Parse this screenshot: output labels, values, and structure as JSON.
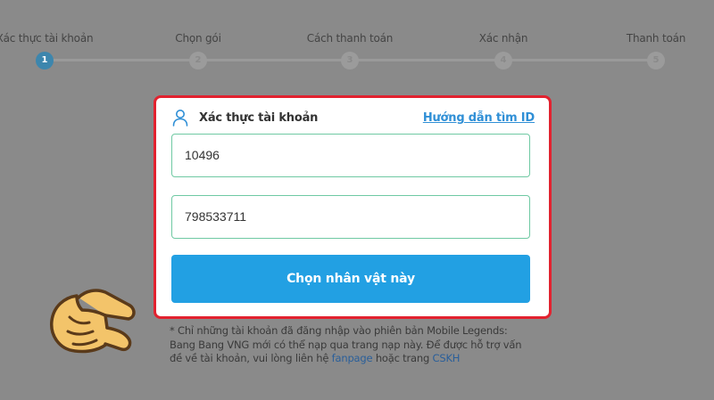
{
  "steps": [
    {
      "label": "Xác thực tài khoản",
      "number": "1"
    },
    {
      "label": "Chọn gói",
      "number": "2"
    },
    {
      "label": "Cách thanh toán",
      "number": "3"
    },
    {
      "label": "Xác nhận",
      "number": "4"
    },
    {
      "label": "Thanh toán",
      "number": "5"
    }
  ],
  "card": {
    "title": "Xác thực tài khoản",
    "help_link": "Hướng dẫn tìm ID",
    "field1_value": "10496",
    "field2_value": "798533711",
    "submit_label": "Chọn nhân vật này"
  },
  "note": {
    "text_1": "* Chỉ những tài khoản đã đăng nhập vào phiên bản Mobile Legends: Bang Bang VNG mới có thể nạp qua trang nạp này. Để được hỗ trợ vấn đề về tài khoản, vui lòng liên hệ ",
    "link_1": "fanpage",
    "text_2": " hoặc trang ",
    "link_2": "CSKH"
  },
  "colors": {
    "highlight": "#e2222f",
    "button": "#22a0e3",
    "link": "#2f8fd6",
    "active_step": "#3d86ad"
  },
  "icons": [
    "user-icon",
    "pointing-hand-icon"
  ]
}
